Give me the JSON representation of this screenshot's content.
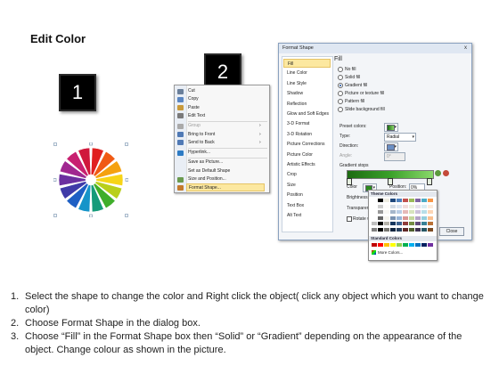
{
  "title": "Edit Color",
  "steps": [
    "1",
    "2"
  ],
  "wheel_colors": [
    "#e02020",
    "#f05a14",
    "#f5a10f",
    "#f7d417",
    "#b9cf1b",
    "#3fae2a",
    "#159b7a",
    "#1694c9",
    "#1d5fc4",
    "#3f3aa8",
    "#6b2fa0",
    "#a02790",
    "#c82070",
    "#d0183c"
  ],
  "context_menu": {
    "items": [
      {
        "label": "Cut",
        "icon": "scissors-icon",
        "disabled": false
      },
      {
        "label": "Copy",
        "icon": "copy-icon",
        "disabled": false
      },
      {
        "label": "Paste",
        "icon": "paste-icon",
        "disabled": false
      },
      {
        "label": "Edit Text",
        "icon": "edit-text-icon",
        "disabled": false
      },
      {
        "label": "Group",
        "icon": "group-icon",
        "disabled": true,
        "arrow": "›"
      },
      {
        "label": "Bring to Front",
        "icon": "bring-front-icon",
        "disabled": false,
        "arrow": "›"
      },
      {
        "label": "Send to Back",
        "icon": "send-back-icon",
        "disabled": false,
        "arrow": "›"
      },
      {
        "label": "Hyperlink...",
        "icon": "hyperlink-icon",
        "disabled": false
      },
      {
        "label": "Save as Picture...",
        "icon": "",
        "disabled": false
      },
      {
        "label": "Set as Default Shape",
        "icon": "",
        "disabled": false
      },
      {
        "label": "Size and Position...",
        "icon": "size-icon",
        "disabled": false
      },
      {
        "label": "Format Shape...",
        "icon": "format-shape-icon",
        "disabled": false,
        "highlight": true
      }
    ]
  },
  "dialog": {
    "title": "Format Shape",
    "close": "x",
    "categories": [
      "Fill",
      "Line Color",
      "Line Style",
      "Shadow",
      "Reflection",
      "Glow and Soft Edges",
      "3-D Format",
      "3-D Rotation",
      "Picture Corrections",
      "Picture Color",
      "Artistic Effects",
      "Crop",
      "Size",
      "Position",
      "Text Box",
      "Alt Text"
    ],
    "fill_heading": "Fill",
    "fill_options": [
      "No fill",
      "Solid fill",
      "Gradient fill",
      "Picture or texture fill",
      "Pattern fill",
      "Slide background fill"
    ],
    "selected_fill": "Gradient fill",
    "preset_colors_label": "Preset colors:",
    "type_label": "Type:",
    "type_value": "Radial",
    "direction_label": "Direction:",
    "angle_label": "Angle:",
    "angle_value": "0°",
    "gradient_stops_label": "Gradient stops",
    "color_label": "Color",
    "position_label": "Position:",
    "position_value": "0%",
    "brightness_label": "Brightness",
    "transparency_label": "Transparency",
    "rotate_label": "Rotate with shape",
    "close_button": "Close"
  },
  "palette": {
    "theme_label": "Theme Colors",
    "standard_label": "Standard Colors",
    "more_label": "More Colors...",
    "theme_row": [
      "#ffffff",
      "#000000",
      "#eeece1",
      "#1f497d",
      "#4f81bd",
      "#c0504d",
      "#9bbb59",
      "#8064a2",
      "#4bacc6",
      "#f79646"
    ],
    "standard_row": [
      "#c00000",
      "#ff0000",
      "#ffc000",
      "#ffff00",
      "#92d050",
      "#00b050",
      "#00b0f0",
      "#0070c0",
      "#002060",
      "#7030a0"
    ]
  },
  "instructions": [
    {
      "num": "1.",
      "text": "Select the shape to change the color and Right click the object( click any object which you want to change color)"
    },
    {
      "num": "2.",
      "text": "Choose Format Shape in the dialog box."
    },
    {
      "num": "3.",
      "text": "Choose “Fill” in the Format Shape box then “Solid” or “Gradient” depending on the appearance of the object. Change colour as shown in the picture."
    }
  ]
}
